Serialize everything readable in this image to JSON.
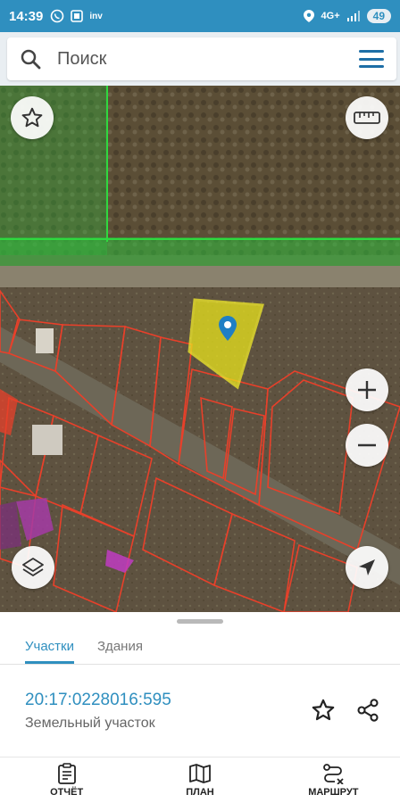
{
  "status_bar": {
    "time": "14:39",
    "network": "4G+",
    "battery": "49",
    "notification_icons": [
      "whatsapp-icon",
      "screenshot-icon",
      "inv-icon"
    ],
    "inv_label": "inv"
  },
  "search": {
    "placeholder": "Поиск"
  },
  "map": {
    "parcel_highlight_color": "#e8e21c",
    "boundary_color": "#e8402a",
    "zone_color": "#2fbf3f"
  },
  "sheet": {
    "tabs": [
      {
        "label": "Участки",
        "active": true
      },
      {
        "label": "Здания",
        "active": false
      }
    ],
    "parcel_number": "20:17:0228016:595",
    "parcel_type": "Земельный участок"
  },
  "nav": {
    "items": [
      {
        "label": "ОТЧЁТ",
        "icon": "report-icon"
      },
      {
        "label": "ПЛАН",
        "icon": "map-icon"
      },
      {
        "label": "МАРШРУТ",
        "icon": "route-icon"
      }
    ]
  },
  "colors": {
    "accent": "#2f8fbf",
    "menu": "#1d6ea6"
  }
}
